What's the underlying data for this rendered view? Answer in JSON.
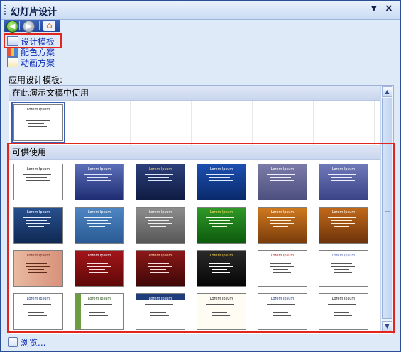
{
  "pane": {
    "title": "幻灯片设计",
    "links": [
      {
        "label": "设计模板",
        "icon": "design-template-icon"
      },
      {
        "label": "配色方案",
        "icon": "color-scheme-icon"
      },
      {
        "label": "动画方案",
        "icon": "animation-scheme-icon"
      }
    ],
    "apply_label": "应用设计模板:",
    "group_in_use": "在此演示文稿中使用",
    "group_available": "可供使用",
    "browse_label": "浏览..."
  },
  "thumb_title": "Lorem Ipsum",
  "in_use": [
    {
      "bg": "#ffffff",
      "title_color": "#1a1a1a",
      "line": "#555555"
    }
  ],
  "available": [
    {
      "bg": "#ffffff",
      "title_color": "#1a1a1a",
      "line": "#555555"
    },
    {
      "bg": "linear-gradient(#5b6fb9,#1f2d73)",
      "title_color": "#ffffff",
      "line": "#e0e6ff"
    },
    {
      "bg": "linear-gradient(#2c3f7a,#0f1c43)",
      "title_color": "#f2d36b",
      "line": "#dfe6ff"
    },
    {
      "bg": "linear-gradient(#1c4fb0,#0a2a6b)",
      "title_color": "#ffffff",
      "line": "#dfe9ff"
    },
    {
      "bg": "linear-gradient(#7a7ba8,#4d4f7e)",
      "title_color": "#ffffff",
      "line": "#eeeeff"
    },
    {
      "bg": "linear-gradient(#6f78b8,#3b4488)",
      "title_color": "#ffffff",
      "line": "#eeeeff"
    },
    {
      "bg": "linear-gradient(#28508f,#0f2954)",
      "title_color": "#ffffff",
      "line": "#e4ecff"
    },
    {
      "bg": "linear-gradient(#4e86c4,#2a5a93)",
      "title_color": "#ffffff",
      "line": "#e8f1ff"
    },
    {
      "bg": "linear-gradient(#8d8d8d,#575757)",
      "title_color": "#ffffff",
      "line": "#f0f0f0"
    },
    {
      "bg": "linear-gradient(#2f9a2a,#0d5a0c)",
      "title_color": "#ffe25c",
      "line": "#f0ffe0"
    },
    {
      "bg": "linear-gradient(#d17a1f,#7a3c0b)",
      "title_color": "#ffffff",
      "line": "#fff1dc"
    },
    {
      "bg": "linear-gradient(#c26a1a,#6d330b)",
      "title_color": "#ffffff",
      "line": "#fff1dc"
    },
    {
      "bg": "linear-gradient(90deg,#e9b9a0,#d8917a)",
      "title_color": "#7a1c1c",
      "line": "#5b2a1b"
    },
    {
      "bg": "linear-gradient(#a4151a,#5e0808)",
      "title_color": "#ffffff",
      "line": "#ffe0e0"
    },
    {
      "bg": "linear-gradient(#8c1818,#3e0707)",
      "title_color": "#ffe6a1",
      "line": "#ffe0e0"
    },
    {
      "bg": "linear-gradient(#2a2a2a,#050505)",
      "title_color": "#ffd54a",
      "line": "#ffffff"
    },
    {
      "bg": "#ffffff",
      "title_color": "#c0271c",
      "line": "#555555"
    },
    {
      "bg": "#ffffff",
      "title_color": "#5a6fb0",
      "line": "#555555"
    },
    {
      "bg": "#ffffff",
      "title_color": "#1e3f8a",
      "line": "#555555"
    },
    {
      "bg": "linear-gradient(90deg,#6e9c43 0 12%,#ffffff 12%)",
      "title_color": "#2c4f1d",
      "line": "#555555"
    },
    {
      "bg": "linear-gradient(#1e3d7a 0 18%,#ffffff 18%)",
      "title_color": "#ffffff",
      "line": "#555555"
    },
    {
      "bg": "#fffdf3",
      "title_color": "#1a1a1a",
      "line": "#555555"
    },
    {
      "bg": "#ffffff",
      "title_color": "#1f3a8a",
      "line": "#555555"
    },
    {
      "bg": "#ffffff",
      "title_color": "#1a1a1a",
      "line": "#555555"
    }
  ]
}
